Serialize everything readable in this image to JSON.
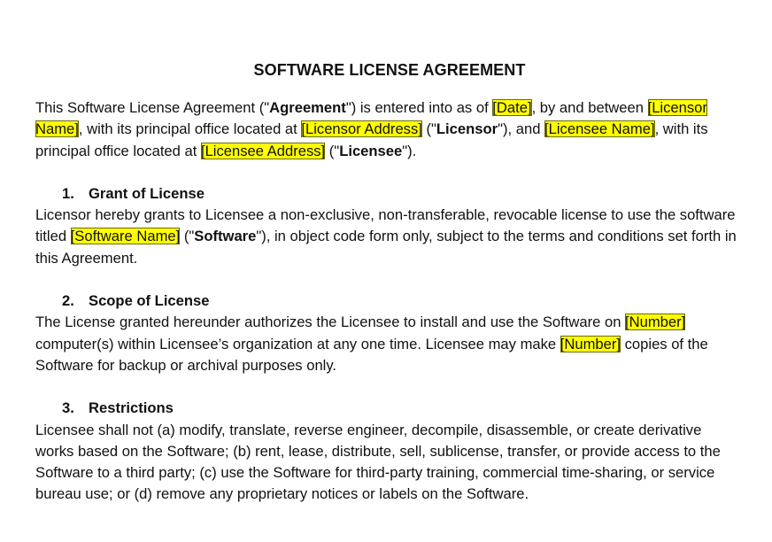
{
  "title": "SOFTWARE LICENSE AGREEMENT",
  "intro": [
    {
      "t": "This Software License Agreement (\"",
      "s": ""
    },
    {
      "t": "Agreement",
      "s": "b"
    },
    {
      "t": "\") is entered into as of ",
      "s": ""
    },
    {
      "t": "[Date]",
      "s": "hl"
    },
    {
      "t": ", by and between ",
      "s": ""
    },
    {
      "t": "[Licensor Name]",
      "s": "hl"
    },
    {
      "t": ", with its principal office located at ",
      "s": ""
    },
    {
      "t": "[Licensor Address]",
      "s": "hl"
    },
    {
      "t": " (\"",
      "s": ""
    },
    {
      "t": "Licensor",
      "s": "b"
    },
    {
      "t": "\"), and ",
      "s": ""
    },
    {
      "t": "[Licensee Name]",
      "s": "hl"
    },
    {
      "t": ", with its principal office located at ",
      "s": ""
    },
    {
      "t": "[Licensee Address]",
      "s": "hl"
    },
    {
      "t": " (\"",
      "s": ""
    },
    {
      "t": "Licensee",
      "s": "b"
    },
    {
      "t": "\").",
      "s": ""
    }
  ],
  "sections": [
    {
      "number": "1.",
      "heading": "Grant of License",
      "body": [
        {
          "t": "Licensor hereby grants to Licensee a non-exclusive, non-transferable, revocable license to use the software titled ",
          "s": ""
        },
        {
          "t": "[Software Name]",
          "s": "hl"
        },
        {
          "t": " (\"",
          "s": ""
        },
        {
          "t": "Software",
          "s": "b"
        },
        {
          "t": "\"), in object code form only, subject to the terms and conditions set forth in this Agreement.",
          "s": ""
        }
      ]
    },
    {
      "number": "2.",
      "heading": "Scope of License",
      "body": [
        {
          "t": "The License granted hereunder authorizes the Licensee to install and use the Software on ",
          "s": ""
        },
        {
          "t": "[Number]",
          "s": "hl"
        },
        {
          "t": " computer(s) within Licensee’s organization at any one time. Licensee may make ",
          "s": ""
        },
        {
          "t": "[Number]",
          "s": "hl"
        },
        {
          "t": " copies of the Software for backup or archival purposes only.",
          "s": ""
        }
      ]
    },
    {
      "number": "3.",
      "heading": "Restrictions",
      "body": [
        {
          "t": "Licensee shall not (a) modify, translate, reverse engineer, decompile, disassemble, or create derivative works based on the Software; (b) rent, lease, distribute, sell, sublicense, transfer, or provide access to the Software to a third party; (c) use the Software for third-party training, commercial time-sharing, or service bureau use; or (d) remove any proprietary notices or labels on the Software.",
          "s": ""
        }
      ]
    }
  ]
}
